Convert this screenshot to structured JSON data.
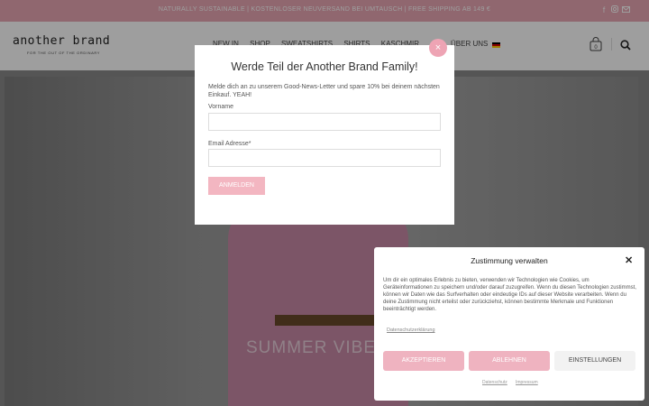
{
  "topbar": {
    "promo": "NATURALLY SUSTAINABLE | KOSTENLOSER NEUVERSAND BEI UMTAUSCH | FREE SHIPPING AB 149 €",
    "social_icons": [
      "facebook-icon",
      "instagram-icon",
      "mail-icon"
    ]
  },
  "header": {
    "logo_name": "another brand",
    "logo_tag": "FOR THE OUT OF THE ORDINARY",
    "nav": [
      "NEW IN",
      "SHOP",
      "SWEATSHIRTS",
      "SHIRTS",
      "KASCHMIR"
    ],
    "nav_right": "ÜBER UNS",
    "language_flag": "de-flag-icon",
    "colors": {
      "promo_bg": "#e9a7b4",
      "accent": "#eea4b4"
    }
  },
  "hero": {
    "title": "SUMMER VIBE"
  },
  "newsletter": {
    "title": "Werde Teil der Another Brand Family!",
    "text": "Melde dich an zu unserem Good-News-Letter und spare 10% bei deinem nächsten Einkauf. YEAH!",
    "firstname_label": "Vorname",
    "firstname_value": "",
    "email_label": "Email Adresse*",
    "email_value": "",
    "submit_label": "ANMELDEN",
    "close_label": "×"
  },
  "consent": {
    "title": "Zustimmung verwalten",
    "close_label": "✕",
    "text": "Um dir ein optimales Erlebnis zu bieten, verwenden wir Technologien wie Cookies, um Geräteinformationen zu speichern und/oder darauf zuzugreifen. Wenn du diesen Technologien zustimmst, können wir Daten wie das Surfverhalten oder eindeutige IDs auf dieser Website verarbeiten. Wenn du deine Zustimmung nicht erteilst oder zurückziehst, können bestimmte Merkmale und Funktionen beeinträchtigt werden.",
    "policy_link": "Datenschutzerklärung",
    "accept_label": "AKZEPTIEREN",
    "deny_label": "ABLEHNEN",
    "settings_label": "EINSTELLUNGEN",
    "footer_links": [
      "Datenschutz",
      "Impressum"
    ]
  }
}
